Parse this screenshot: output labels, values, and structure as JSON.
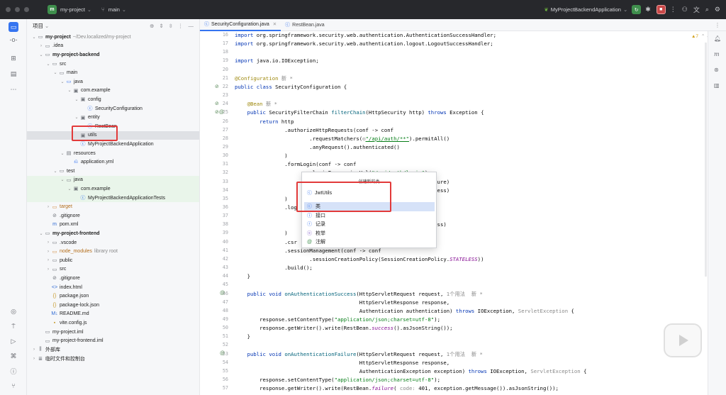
{
  "titlebar": {
    "project_badge": "m",
    "project_name": "my-project",
    "branch_icon": "branch-icon",
    "branch": "main",
    "run_config": "MyProjectBackendApplication",
    "run_config_icon": "spring-icon"
  },
  "project_panel": {
    "title": "项目",
    "rows": [
      {
        "label": "my-project",
        "hint": "~/Dev.localized/my-project",
        "icon": "folder-icon",
        "depth": 0,
        "open": true,
        "bold": true
      },
      {
        "label": ".idea",
        "icon": "folder-icon",
        "depth": 1,
        "open": false
      },
      {
        "label": "my-project-backend",
        "icon": "folder-icon",
        "depth": 1,
        "open": true,
        "bold": true
      },
      {
        "label": "src",
        "icon": "folder-icon",
        "depth": 2,
        "open": true
      },
      {
        "label": "main",
        "icon": "folder-icon",
        "depth": 3,
        "open": true
      },
      {
        "label": "java",
        "icon": "source-folder-icon",
        "depth": 4,
        "open": true
      },
      {
        "label": "com.example",
        "icon": "package-icon",
        "depth": 5,
        "open": true
      },
      {
        "label": "config",
        "icon": "package-icon",
        "depth": 6,
        "open": true
      },
      {
        "label": "SecurityConfiguration",
        "icon": "class-icon",
        "depth": 7,
        "leaf": true
      },
      {
        "label": "entity",
        "icon": "package-icon",
        "depth": 6,
        "open": true
      },
      {
        "label": "RestBean",
        "icon": "class-icon",
        "depth": 7,
        "leaf": true
      },
      {
        "label": "utils",
        "icon": "package-icon",
        "depth": 6,
        "leaf": true,
        "selected": true
      },
      {
        "label": "MyProjectBackendApplication",
        "icon": "spring-class-icon",
        "depth": 6,
        "leaf": true
      },
      {
        "label": "resources",
        "icon": "resources-folder-icon",
        "depth": 4,
        "open": true
      },
      {
        "label": "application.yml",
        "icon": "yaml-icon",
        "depth": 5,
        "leaf": true
      },
      {
        "label": "test",
        "icon": "folder-icon",
        "depth": 3,
        "open": true
      },
      {
        "label": "java",
        "icon": "test-folder-icon",
        "depth": 4,
        "open": true,
        "green": true
      },
      {
        "label": "com.example",
        "icon": "package-icon",
        "depth": 5,
        "open": true,
        "green": true
      },
      {
        "label": "MyProjectBackendApplicationTests",
        "icon": "spring-class-icon",
        "depth": 6,
        "leaf": true,
        "green": true
      },
      {
        "label": "target",
        "icon": "folder-orange-icon",
        "depth": 2,
        "open": false,
        "orange": true
      },
      {
        "label": ".gitignore",
        "icon": "ignore-icon",
        "depth": 2,
        "leaf": true
      },
      {
        "label": "pom.xml",
        "icon": "maven-icon",
        "depth": 2,
        "leaf": true
      },
      {
        "label": "my-project-frontend",
        "icon": "folder-icon",
        "depth": 1,
        "open": true,
        "bold": true
      },
      {
        "label": ".vscode",
        "icon": "folder-icon",
        "depth": 2,
        "open": false
      },
      {
        "label": "node_modules",
        "hint": "library root",
        "icon": "folder-orange-icon",
        "depth": 2,
        "open": false,
        "orange": true
      },
      {
        "label": "public",
        "icon": "folder-icon",
        "depth": 2,
        "open": false
      },
      {
        "label": "src",
        "icon": "folder-icon",
        "depth": 2,
        "open": false
      },
      {
        "label": ".gitignore",
        "icon": "ignore-icon",
        "depth": 2,
        "leaf": true
      },
      {
        "label": "index.html",
        "icon": "html-icon",
        "depth": 2,
        "leaf": true
      },
      {
        "label": "package.json",
        "icon": "json-icon",
        "depth": 2,
        "leaf": true
      },
      {
        "label": "package-lock.json",
        "icon": "json-icon",
        "depth": 2,
        "leaf": true
      },
      {
        "label": "README.md",
        "icon": "markdown-icon",
        "depth": 2,
        "leaf": true
      },
      {
        "label": "vite.config.js",
        "icon": "js-icon",
        "depth": 2,
        "leaf": true
      },
      {
        "label": "my-project.iml",
        "icon": "iml-icon",
        "depth": 1,
        "leaf": true
      },
      {
        "label": "my-project-frontend.iml",
        "icon": "iml-icon",
        "depth": 1,
        "leaf": true
      },
      {
        "label": "外部库",
        "icon": "library-icon",
        "depth": 0,
        "open": false
      },
      {
        "label": "临时文件和控制台",
        "icon": "scratch-icon",
        "depth": 0,
        "open": false
      }
    ]
  },
  "tabs": [
    {
      "label": "SecurityConfiguration.java",
      "active": true
    },
    {
      "label": "RestBean.java",
      "active": false
    }
  ],
  "editor": {
    "inspection_count": "▲7",
    "lines": [
      {
        "n": "16",
        "html": "<span class=\"kw\">import</span> org.springframework.security.web.authentication.AuthenticationSuccessHandler;"
      },
      {
        "n": "17",
        "html": "<span class=\"kw\">import</span> org.springframework.security.web.authentication.logout.LogoutSuccessHandler;"
      },
      {
        "n": "18",
        "html": ""
      },
      {
        "n": "19",
        "html": "<span class=\"kw\">import</span> java.io.IOException;"
      },
      {
        "n": "20",
        "html": ""
      },
      {
        "n": "21",
        "html": "<span class=\"an\">@Configuration</span> <span class=\"gr\">新 *</span>"
      },
      {
        "n": "22",
        "html": "<span class=\"kw\">public class</span> SecurityConfiguration {"
      },
      {
        "n": "23",
        "html": ""
      },
      {
        "n": "24",
        "html": "    <span class=\"an\">@Bean</span> <span class=\"gr\">新 *</span>"
      },
      {
        "n": "25",
        "html": "    <span class=\"kw\">public</span> SecurityFilterChain <span class=\"mth\">filterChain</span>(HttpSecurity http) <span class=\"kw\">throws</span> Exception {"
      },
      {
        "n": "26",
        "html": "        <span class=\"kw\">return</span> http"
      },
      {
        "n": "27",
        "html": "                .authorizeHttpRequests(conf -> conf"
      },
      {
        "n": "28",
        "html": "                        .requestMatchers(<span class=\"gr\">◎</span><span class=\"strl\">\"/api/auth/**\"</span>).permitAll()"
      },
      {
        "n": "29",
        "html": "                        .anyRequest().authenticated()"
      },
      {
        "n": "30",
        "html": "                )"
      },
      {
        "n": "31",
        "html": "                .formLogin(conf -> conf"
      },
      {
        "n": "32",
        "html": "                        .loginProcessingUrl(<span class=\"str\">\"/api/auth/login\"</span>)"
      },
      {
        "n": "33",
        "html": "                                                         tionFailure)"
      },
      {
        "n": "34",
        "html": "                                                         tionSuccess)"
      },
      {
        "n": "35",
        "html": "                )"
      },
      {
        "n": "36",
        "html": "                .log"
      },
      {
        "n": "37",
        "html": ""
      },
      {
        "n": "38",
        "html": "                                                          utSuccess)"
      },
      {
        "n": "39",
        "html": "                )"
      },
      {
        "n": "40",
        "html": "                .csr"
      },
      {
        "n": "41",
        "html": "                .sessionManagement(conf -> conf"
      },
      {
        "n": "42",
        "html": "                        .sessionCreationPolicy(SessionCreationPolicy.<span class=\"it\">STATELESS</span>))"
      },
      {
        "n": "43",
        "html": "                .build();"
      },
      {
        "n": "44",
        "html": "    }"
      },
      {
        "n": "45",
        "html": ""
      },
      {
        "n": "46",
        "html": "    <span class=\"kw\">public void</span> <span class=\"mth\">onAuthenticationSuccess</span>(HttpServletRequest request, <span class=\"gr\">1个用法  新 *</span>"
      },
      {
        "n": "47",
        "html": "                                        HttpServletResponse response,"
      },
      {
        "n": "48",
        "html": "                                        Authentication authentication) <span class=\"kw\">throws</span> IOException, <span class=\"gr\">ServletException</span> {"
      },
      {
        "n": "49",
        "html": "        response.setContentType(<span class=\"str\">\"application/json;charset=utf-8\"</span>);"
      },
      {
        "n": "50",
        "html": "        response.getWriter().write(RestBean.<span class=\"it\">success</span>().asJsonString());"
      },
      {
        "n": "51",
        "html": "    }"
      },
      {
        "n": "52",
        "html": ""
      },
      {
        "n": "53",
        "html": "    <span class=\"kw\">public void</span> <span class=\"mth\">onAuthenticationFailure</span>(HttpServletRequest request, <span class=\"gr\">1个用法  新 *</span>"
      },
      {
        "n": "54",
        "html": "                                        HttpServletResponse response,"
      },
      {
        "n": "55",
        "html": "                                        AuthenticationException exception) <span class=\"kw\">throws</span> IOException, <span class=\"gr\">ServletException</span> {"
      },
      {
        "n": "56",
        "html": "        response.setContentType(<span class=\"str\">\"application/json;charset=utf-8\"</span>);"
      },
      {
        "n": "57",
        "html": "        response.getWriter().write(RestBean.<span class=\"it\">failure</span>( <span class=\"gr\">code:</span> 401, exception.getMessage()).asJsonString());"
      }
    ]
  },
  "popup": {
    "title": "创建新的类",
    "input_value": "JwtUtils",
    "items": [
      {
        "label": "类",
        "icon": "class-icon",
        "selected": true
      },
      {
        "label": "接口",
        "icon": "interface-icon",
        "selected": false
      },
      {
        "label": "记录",
        "icon": "record-icon",
        "selected": false
      },
      {
        "label": "枚举",
        "icon": "enum-icon",
        "selected": false
      },
      {
        "label": "注解",
        "icon": "annotation-icon",
        "selected": false
      }
    ]
  }
}
